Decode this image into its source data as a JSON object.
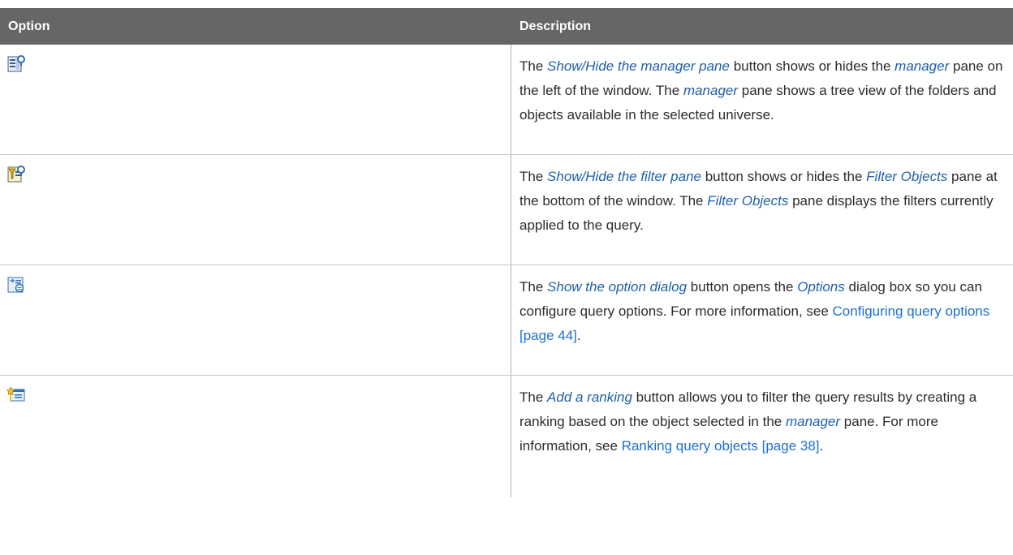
{
  "table": {
    "headers": [
      "Option",
      "Description"
    ],
    "rows": [
      {
        "icon": "show-hide-manager-pane-icon",
        "parts": [
          {
            "t": "The ",
            "s": "text"
          },
          {
            "t": "Show/Hide the manager pane",
            "s": "em"
          },
          {
            "t": " button shows or hides the ",
            "s": "text"
          },
          {
            "t": "manager",
            "s": "em"
          },
          {
            "t": " pane on the left of the window. The ",
            "s": "text"
          },
          {
            "t": "manager",
            "s": "em"
          },
          {
            "t": " pane shows a tree view of the folders and objects available in the selected universe.",
            "s": "text"
          }
        ]
      },
      {
        "icon": "show-hide-filter-pane-icon",
        "parts": [
          {
            "t": "The ",
            "s": "text"
          },
          {
            "t": "Show/Hide the filter pane",
            "s": "em"
          },
          {
            "t": " button shows or hides the ",
            "s": "text"
          },
          {
            "t": "Filter Objects",
            "s": "em"
          },
          {
            "t": " pane at the bottom of the window. The ",
            "s": "text"
          },
          {
            "t": "Filter Objects",
            "s": "em"
          },
          {
            "t": " pane displays the filters currently applied to the query.",
            "s": "text"
          }
        ]
      },
      {
        "icon": "show-option-dialog-icon",
        "parts": [
          {
            "t": "The ",
            "s": "text"
          },
          {
            "t": "Show the option dialog",
            "s": "em"
          },
          {
            "t": " button opens the ",
            "s": "text"
          },
          {
            "t": "Options",
            "s": "em"
          },
          {
            "t": " dialog box so you can configure query options. For more information, see ",
            "s": "text"
          },
          {
            "t": "Configuring query options [page 44]",
            "s": "link"
          },
          {
            "t": ".",
            "s": "text"
          }
        ]
      },
      {
        "icon": "add-ranking-icon",
        "parts": [
          {
            "t": "The ",
            "s": "text"
          },
          {
            "t": "Add a ranking",
            "s": "em"
          },
          {
            "t": " button allows you to filter the query results by creating a ranking based on the object selected in the ",
            "s": "text"
          },
          {
            "t": "manager",
            "s": "em"
          },
          {
            "t": " pane. For more information, see ",
            "s": "text"
          },
          {
            "t": "Ranking query objects [page 38]",
            "s": "link"
          },
          {
            "t": ".",
            "s": "text"
          }
        ]
      }
    ]
  }
}
